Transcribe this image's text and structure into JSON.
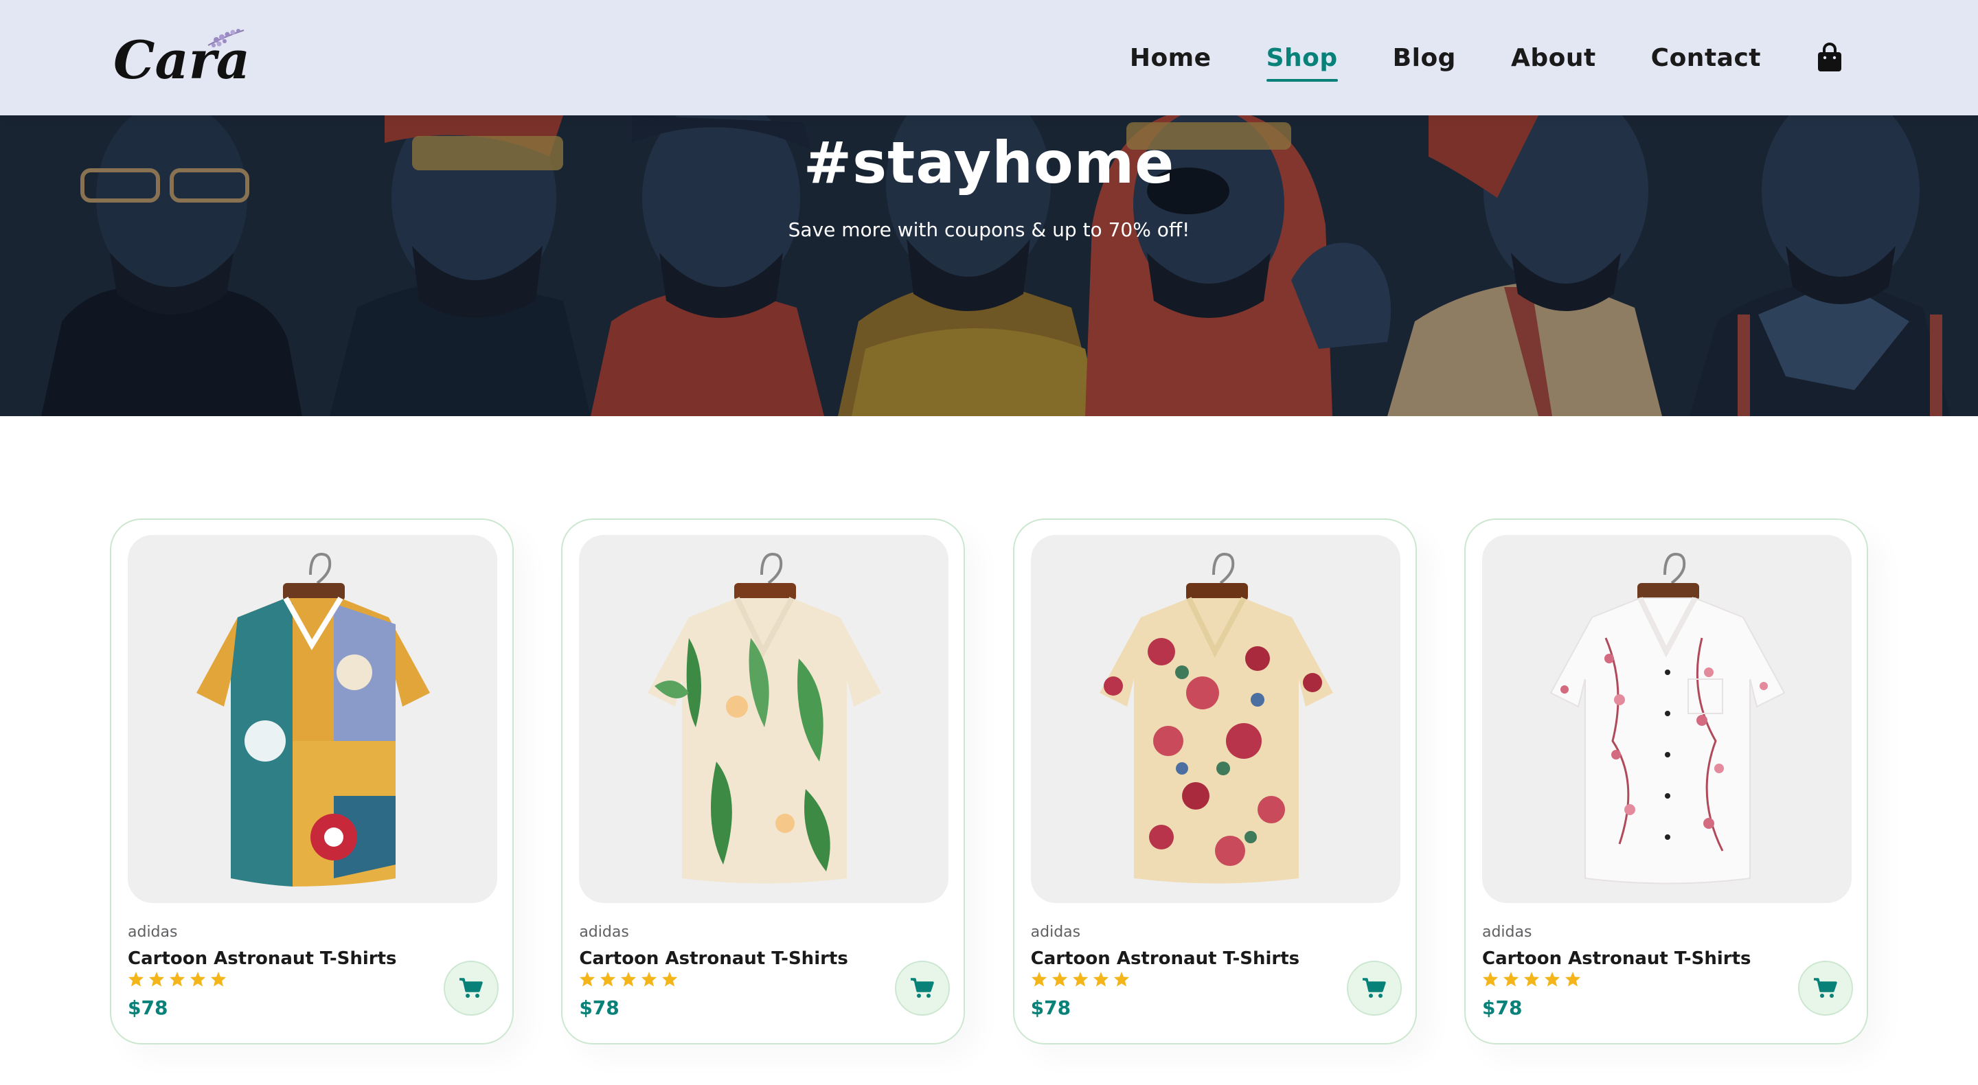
{
  "brand": {
    "logo_text": "Cara"
  },
  "nav": {
    "items": [
      {
        "label": "Home",
        "active": false
      },
      {
        "label": "Shop",
        "active": true
      },
      {
        "label": "Blog",
        "active": false
      },
      {
        "label": "About",
        "active": false
      },
      {
        "label": "Contact",
        "active": false
      }
    ],
    "cart_icon": "shopping-bag-icon"
  },
  "hero": {
    "title": "#stayhome",
    "subtitle": "Save more with coupons & up to 70% off!"
  },
  "products": [
    {
      "brand": "adidas",
      "name": "Cartoon Astronaut T-Shirts",
      "rating": 5,
      "price": "$78",
      "cart_icon": "cart-icon"
    },
    {
      "brand": "adidas",
      "name": "Cartoon Astronaut T-Shirts",
      "rating": 5,
      "price": "$78",
      "cart_icon": "cart-icon"
    },
    {
      "brand": "adidas",
      "name": "Cartoon Astronaut T-Shirts",
      "rating": 5,
      "price": "$78",
      "cart_icon": "cart-icon"
    },
    {
      "brand": "adidas",
      "name": "Cartoon Astronaut T-Shirts",
      "rating": 5,
      "price": "$78",
      "cart_icon": "cart-icon"
    }
  ],
  "colors": {
    "accent": "#088178",
    "header_bg": "#e3e6f3",
    "star": "#f3b519",
    "card_border": "#cce7d0",
    "cart_bg": "#e8f6ea"
  }
}
